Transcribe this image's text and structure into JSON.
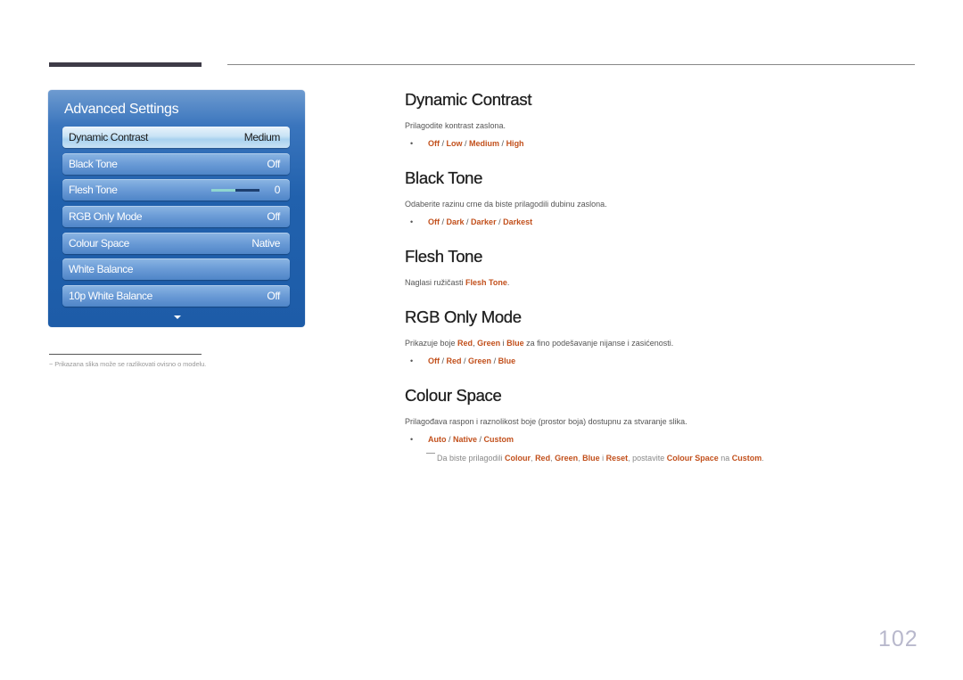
{
  "osd": {
    "title": "Advanced Settings",
    "items": [
      {
        "label": "Dynamic Contrast",
        "value": "Medium",
        "selected": true
      },
      {
        "label": "Black Tone",
        "value": "Off"
      },
      {
        "label": "Flesh Tone",
        "value": "0",
        "slider_fraction": 0.5
      },
      {
        "label": "RGB Only Mode",
        "value": "Off"
      },
      {
        "label": "Colour Space",
        "value": "Native"
      },
      {
        "label": "White Balance",
        "value": ""
      },
      {
        "label": "10p White Balance",
        "value": "Off"
      }
    ],
    "more_icon": "chevron-down-icon"
  },
  "footnote": "−  Prikazana slika može se razlikovati ovisno o modelu.",
  "sections": {
    "dynamic_contrast": {
      "title": "Dynamic Contrast",
      "description": "Prilagodite kontrast zaslona.",
      "options": [
        "Off",
        "Low",
        "Medium",
        "High"
      ]
    },
    "black_tone": {
      "title": "Black Tone",
      "description": "Odaberite razinu crne da biste prilagodili dubinu zaslona.",
      "options": [
        "Off",
        "Dark",
        "Darker",
        "Darkest"
      ]
    },
    "flesh_tone": {
      "title": "Flesh Tone",
      "description_prefix": "Naglasi ružičasti ",
      "description_highlight": "Flesh Tone",
      "description_suffix": "."
    },
    "rgb_only_mode": {
      "title": "RGB Only Mode",
      "description_prefix": "Prikazuje boje ",
      "hl_red": "Red",
      "sep1": ", ",
      "hl_green": "Green",
      "sep2": " i ",
      "hl_blue": "Blue",
      "description_suffix": " za fino podešavanje nijanse i zasićenosti.",
      "options": [
        "Off",
        "Red",
        "Green",
        "Blue"
      ]
    },
    "colour_space": {
      "title": "Colour Space",
      "description": "Prilagođava raspon i raznolikost boje (prostor boja) dostupnu za stvaranje slika.",
      "options": [
        "Auto",
        "Native",
        "Custom"
      ],
      "note": {
        "prefix": "Da biste prilagodili ",
        "colour": "Colour",
        "c1": ", ",
        "red": "Red",
        "c2": ", ",
        "green": "Green",
        "c3": ", ",
        "blue": "Blue",
        "c4": " i ",
        "reset": "Reset",
        "c5": ", postavite ",
        "colour_space": "Colour Space",
        "c6": " na ",
        "custom": "Custom",
        "suffix": "."
      }
    }
  },
  "option_separator": " / ",
  "bullet": "•",
  "page_number": "102",
  "colors": {
    "highlight": "#c2501c",
    "osd_blue": "#1d5ca8"
  }
}
